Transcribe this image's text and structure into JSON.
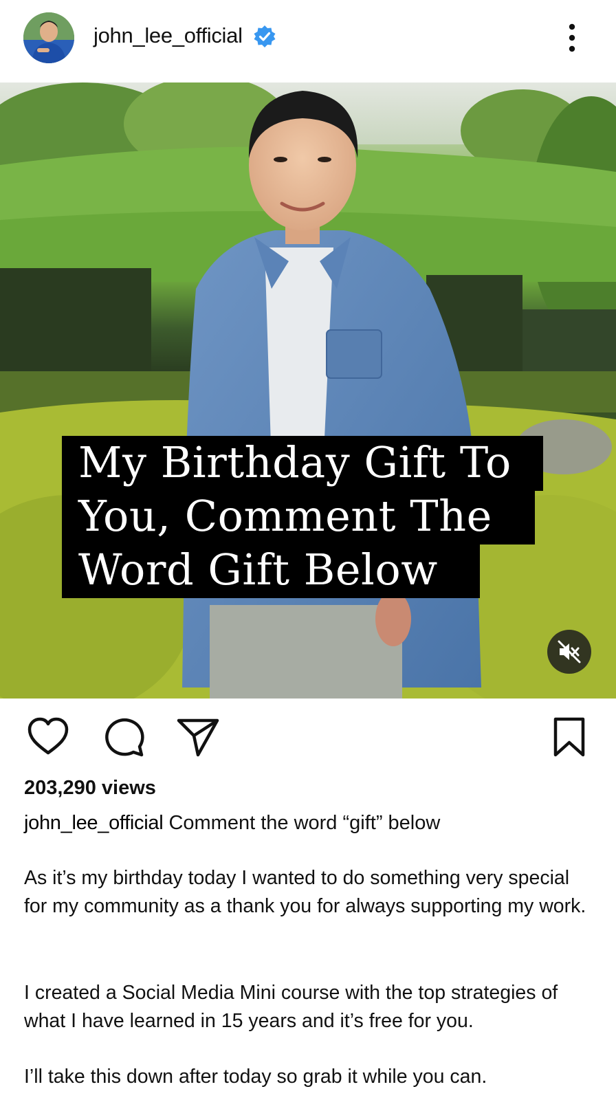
{
  "post": {
    "username": "john_lee_official",
    "verified": true,
    "more_menu_icon": "more-vertical-icon"
  },
  "media": {
    "overlay_lines": [
      "My Birthday Gift To",
      "You, Comment The",
      "Word Gift Below"
    ],
    "muted": true,
    "mute_icon": "speaker-muted-icon"
  },
  "actions": {
    "like_icon": "heart-icon",
    "comment_icon": "comment-icon",
    "share_icon": "send-icon",
    "save_icon": "bookmark-icon"
  },
  "stats": {
    "views": "203,290 views"
  },
  "caption": {
    "username": "john_lee_official",
    "first_line": "Comment the word “gift” below",
    "paragraphs": [
      "As it’s my birthday today I wanted to do something very special for my community as a thank you for always supporting my work.",
      "I created a Social Media Mini course with the top strategies of what I have learned in 15 years and it’s free for you.",
      "I’ll take this down after today so grab it while you can."
    ]
  },
  "colors": {
    "verified_blue": "#3897f0",
    "text": "#111111",
    "overlay_bg": "#000000"
  }
}
